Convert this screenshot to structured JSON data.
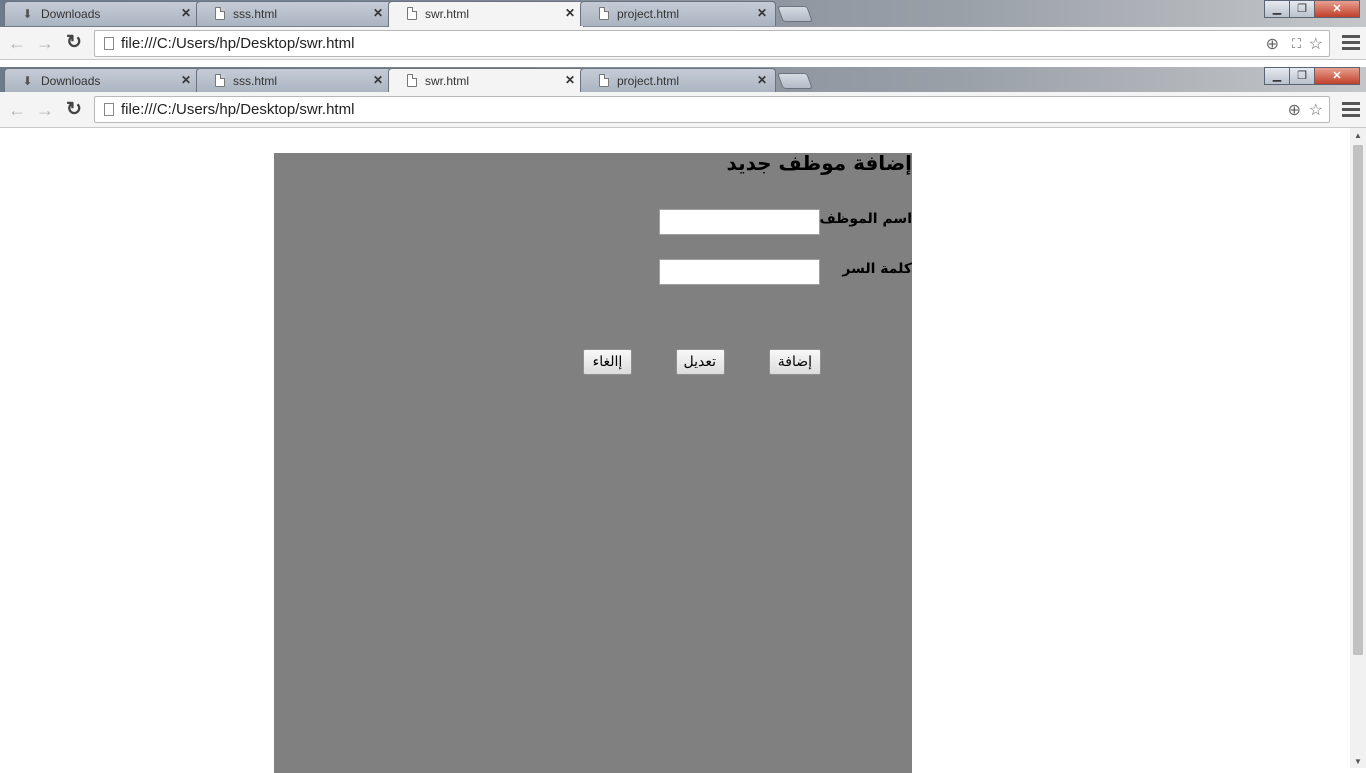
{
  "window_back": {
    "tabs": [
      {
        "label": "Downloads",
        "icon": "download-icon"
      },
      {
        "label": "sss.html",
        "icon": "page-icon"
      },
      {
        "label": "swr.html",
        "icon": "page-icon",
        "active": true
      },
      {
        "label": "project.html",
        "icon": "page-icon"
      }
    ],
    "url": "file:///C:/Users/hp/Desktop/swr.html"
  },
  "window_front": {
    "tabs": [
      {
        "label": "Downloads",
        "icon": "download-icon"
      },
      {
        "label": "sss.html",
        "icon": "page-icon"
      },
      {
        "label": "swr.html",
        "icon": "page-icon",
        "active": true
      },
      {
        "label": "project.html",
        "icon": "page-icon"
      }
    ],
    "url": "file:///C:/Users/hp/Desktop/swr.html"
  },
  "form": {
    "title": "إضافة موظف جديد",
    "employee_name_label": "اسم الموظف",
    "employee_name_value": "",
    "password_label": "كلمة السر",
    "password_value": "",
    "add_button": "إضافة",
    "edit_button": "تعديل",
    "cancel_button": "إالغاء"
  },
  "colors": {
    "panel_bg": "#808080",
    "page_bg": "#ffffff"
  }
}
